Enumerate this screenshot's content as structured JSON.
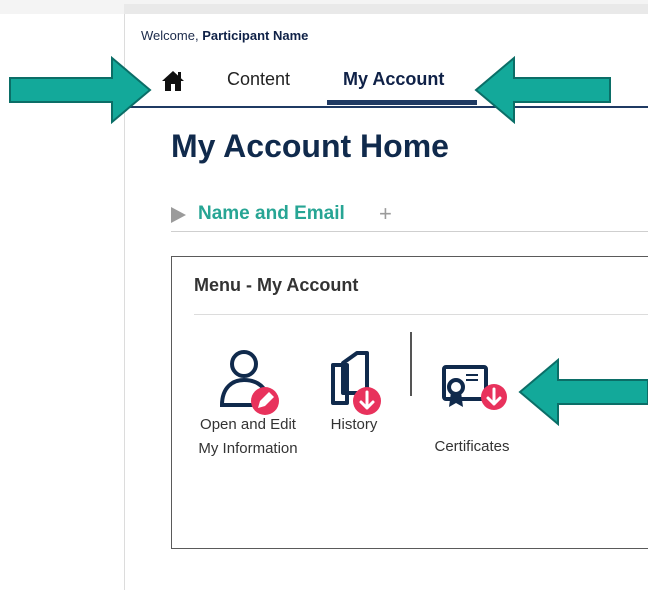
{
  "header": {
    "welcome_prefix": "Welcome,",
    "user_name": "Participant Name"
  },
  "nav": {
    "home_icon": "home-icon",
    "tabs": [
      {
        "label": "Content"
      },
      {
        "label": "My Account",
        "active": true
      }
    ]
  },
  "page": {
    "title": "My Account Home",
    "section": {
      "label": "Name and Email",
      "expand_symbol": "+"
    }
  },
  "menu": {
    "title": "Menu - My Account",
    "items": [
      {
        "label": "Open and Edit My Information",
        "icon": "user-edit-icon",
        "badge_icon": "pencil-icon"
      },
      {
        "label": "History",
        "icon": "documents-icon",
        "badge_icon": "download-icon"
      },
      {
        "label": "Certificates",
        "icon": "certificate-icon",
        "badge_icon": "download-icon"
      }
    ]
  },
  "colors": {
    "navy": "#102a4c",
    "teal_link": "#27a594",
    "badge_pink": "#e8325c",
    "annotation_arrow": "#13a99a"
  },
  "annotations": {
    "arrows": 3
  }
}
